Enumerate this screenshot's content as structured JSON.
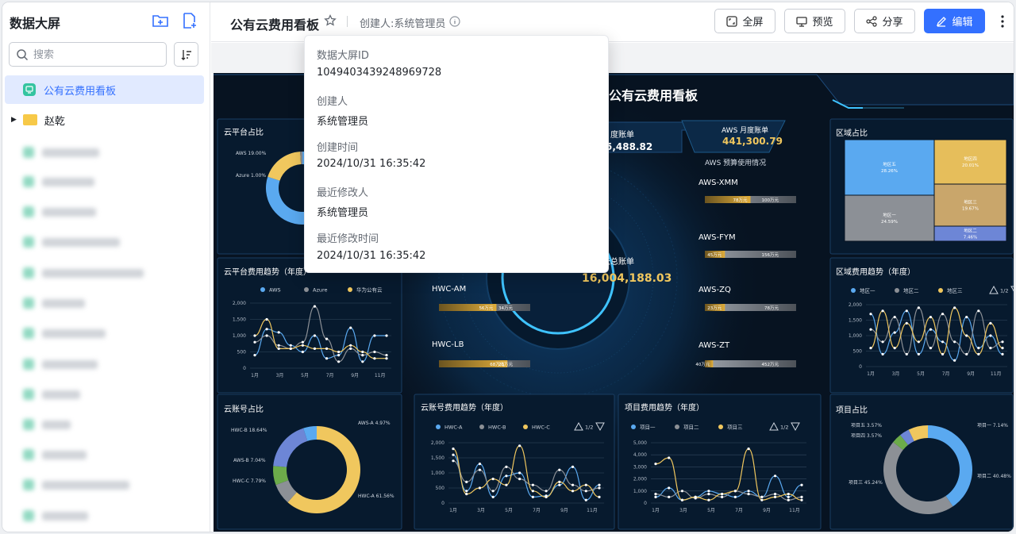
{
  "sidebar": {
    "title": "数据大屏",
    "search_placeholder": "搜索",
    "items": [
      {
        "label": "公有云费用看板",
        "active": true
      },
      {
        "label": "赵乾",
        "type": "folder"
      }
    ]
  },
  "header": {
    "title": "公有云费用看板",
    "creator": "创建人:系统管理员",
    "buttons": {
      "fullscreen": "全屏",
      "preview": "预览",
      "share": "分享",
      "edit": "编辑"
    }
  },
  "popup": {
    "fields": [
      {
        "label": "数据大屏ID",
        "value": "1049403439248969728"
      },
      {
        "label": "创建人",
        "value": "系统管理员"
      },
      {
        "label": "创建时间",
        "value": "2024/10/31 16:35:42"
      },
      {
        "label": "最近修改人",
        "value": "系统管理员"
      },
      {
        "label": "最近修改时间",
        "value": "2024/10/31 16:35:42"
      }
    ]
  },
  "dashboard": {
    "title": "公有云费用看板",
    "center": {
      "total_label": "云总账单",
      "total_value": "16,004,188.03",
      "month_label": "度账单",
      "month_value": "5,488.82",
      "aws_month_label": "AWS 月度账单",
      "aws_month_value": "441,300.79",
      "budget_label": "AWS 预算使用情况"
    },
    "budgets": [
      {
        "name": "AWS-XMM",
        "used": "78万元",
        "total": "100万元",
        "ratio": 0.5
      },
      {
        "name": "AWS-FYM",
        "used": "45万元",
        "total": "156万元",
        "ratio": 0.22
      },
      {
        "name": "AWS-ZQ",
        "used": "23万元",
        "total": "78万元",
        "ratio": 0.22
      },
      {
        "name": "AWS-ZT",
        "used": "40万元",
        "total": "452万元",
        "ratio": 0.09
      },
      {
        "name": "HWC-AM",
        "used": "56万元",
        "total": "34万元",
        "ratio": 0.63
      },
      {
        "name": "HWC-LB",
        "used": "68万元",
        "total": "23万元",
        "ratio": 0.75
      }
    ],
    "panels": {
      "cloud_share": {
        "title": "云平台占比",
        "labels": [
          "AWS 19.00%",
          "Azure 1.00%"
        ]
      },
      "cloud_trend": {
        "title": "云平台费用趋势（年度）",
        "legend": [
          "AWS",
          "Azure",
          "华为公有云"
        ]
      },
      "account_share": {
        "title": "云账号占比",
        "labels": [
          "HWC-B 18.64%",
          "AWS-A 4.97%",
          "AWS-B 7.04%",
          "HWC-C 7.79%",
          "HWC-A 61.56%"
        ]
      },
      "account_trend": {
        "title": "云账号费用趋势（年度）",
        "legend": [
          "HWC-A",
          "HWC-B",
          "HWC-C"
        ],
        "page": "1/2"
      },
      "project_trend": {
        "title": "项目费用趋势（年度）",
        "legend": [
          "项目一",
          "项目二",
          "项目三"
        ],
        "page": "1/2"
      },
      "region_share": {
        "title": "区域占比",
        "cells": [
          {
            "name": "地区五",
            "pct": "28.26%"
          },
          {
            "name": "地区四",
            "pct": "20.01%"
          },
          {
            "name": "地区三",
            "pct": "19.67%"
          },
          {
            "name": "地区一",
            "pct": "24.59%"
          },
          {
            "name": "地区二",
            "pct": "7.46%"
          }
        ]
      },
      "region_trend": {
        "title": "区域费用趋势（年度）",
        "legend": [
          "地区一",
          "地区二",
          "地区三"
        ],
        "page": "1/2"
      },
      "project_share": {
        "title": "项目占比",
        "labels": [
          "项目五 3.57%",
          "项目四 3.57%",
          "项目一 7.14%",
          "项目二 40.48%",
          "项目三 45.24%"
        ]
      }
    },
    "axis": {
      "y2000": [
        "2,000",
        "1,500",
        "1,000",
        "500",
        "0"
      ],
      "y5000": [
        "5,000",
        "4,000",
        "3,000",
        "2,000",
        "1,000",
        "0"
      ],
      "x": [
        "1月",
        "3月",
        "5月",
        "7月",
        "9月",
        "11月"
      ]
    },
    "colors": {
      "blue": "#5aa9f0",
      "grey": "#8c9096",
      "yellow": "#f0c75e",
      "gold": "#d8a83a",
      "cyan": "#3fc3ff",
      "bg": "#071321"
    }
  }
}
